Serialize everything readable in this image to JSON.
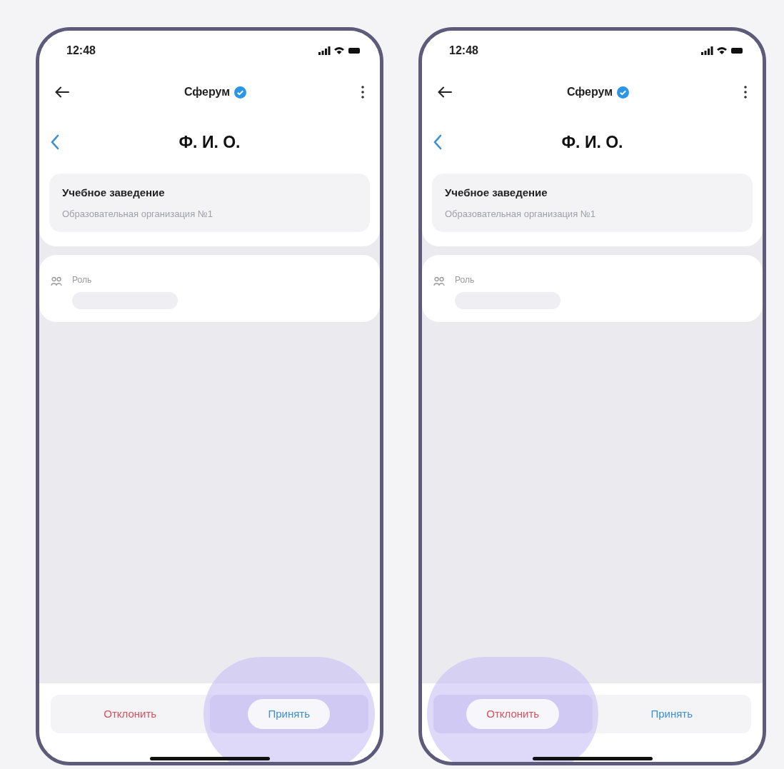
{
  "phones": [
    {
      "status_bar": {
        "time": "12:48"
      },
      "header": {
        "title": "Сферум"
      },
      "page_title": "Ф. И. О.",
      "institution": {
        "label": "Учебное заведение",
        "value": "Образовательная организация №1"
      },
      "role": {
        "label": "Роль"
      },
      "actions": [
        {
          "kind": "decline",
          "label": "Отклонить",
          "pressed": false
        },
        {
          "kind": "accept",
          "label": "Принять",
          "pressed": true
        }
      ]
    },
    {
      "status_bar": {
        "time": "12:48"
      },
      "header": {
        "title": "Сферум"
      },
      "page_title": "Ф. И. О.",
      "institution": {
        "label": "Учебное заведение",
        "value": "Образовательная организация №1"
      },
      "role": {
        "label": "Роль"
      },
      "actions": [
        {
          "kind": "decline",
          "label": "Отклонить",
          "pressed": true
        },
        {
          "kind": "accept",
          "label": "Принять",
          "pressed": false
        }
      ]
    }
  ]
}
